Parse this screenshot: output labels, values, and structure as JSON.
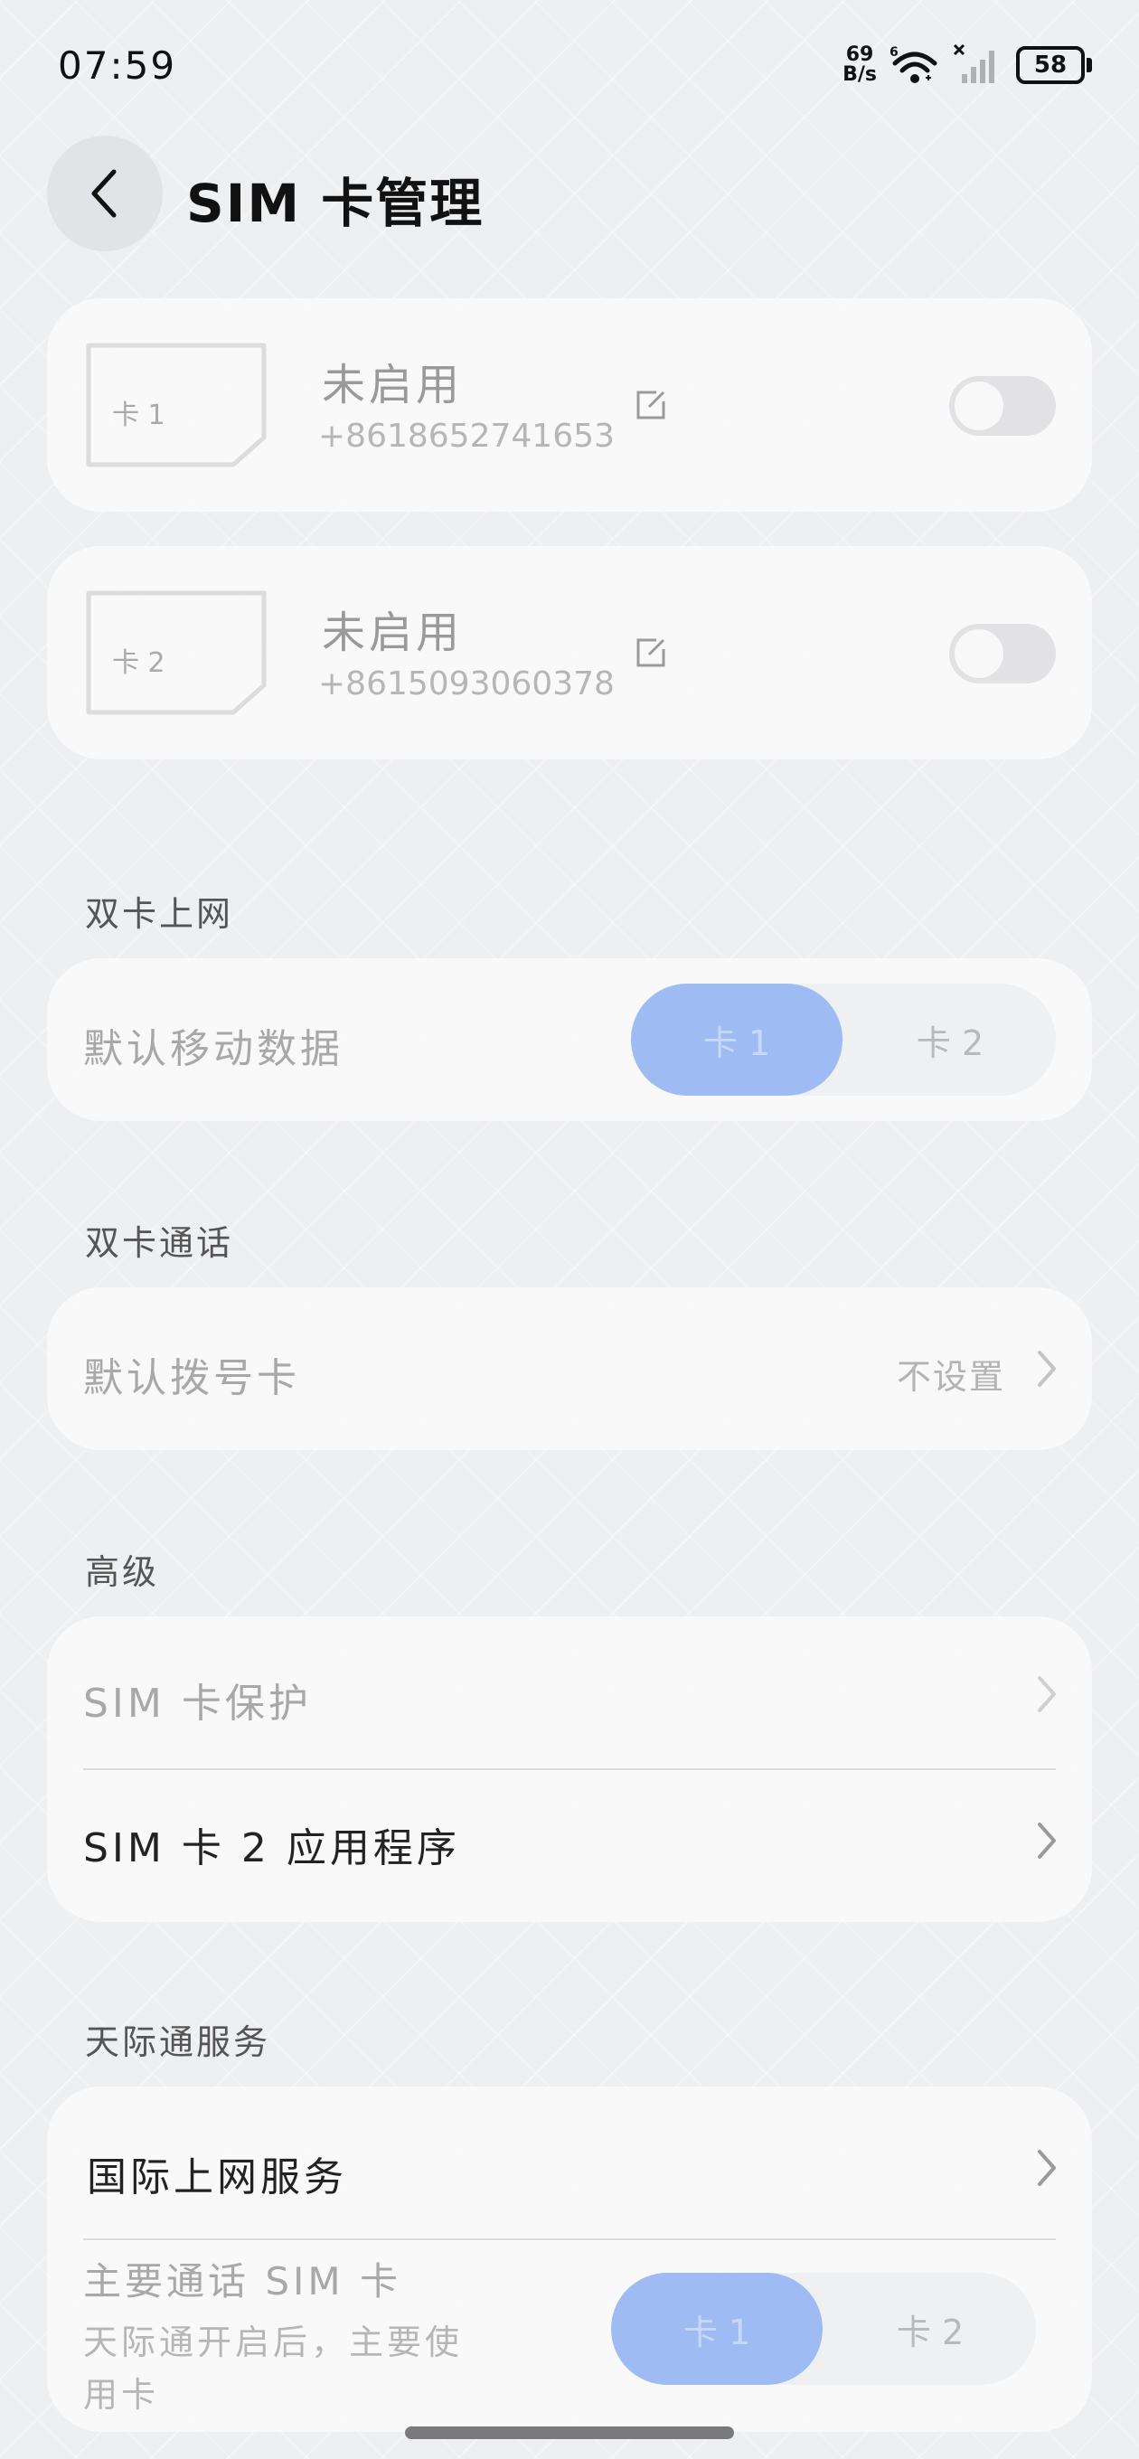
{
  "status_bar": {
    "time": "07:59",
    "net_speed_value": "69",
    "net_speed_unit": "B/s",
    "battery": "58"
  },
  "header": {
    "title": "SIM 卡管理"
  },
  "sim_cards": [
    {
      "label": "卡 1",
      "status": "未启用",
      "number": "+8618652741653",
      "enabled": false
    },
    {
      "label": "卡 2",
      "status": "未启用",
      "number": "+8615093060378",
      "enabled": false
    }
  ],
  "dual_data": {
    "section": "双卡上网",
    "row_label": "默认移动数据",
    "options": [
      "卡 1",
      "卡 2"
    ],
    "selected": "卡 1"
  },
  "dual_call": {
    "section": "双卡通话",
    "row_label": "默认拨号卡",
    "value": "不设置"
  },
  "advanced": {
    "section": "高级",
    "items": [
      "SIM 卡保护",
      "SIM 卡 2 应用程序"
    ]
  },
  "tianjitong": {
    "section": "天际通服务",
    "item": "国际上网服务",
    "primary_label": "主要通话 SIM 卡",
    "primary_desc_line1": "天际通开启后，主要使",
    "primary_desc_line2": "用卡",
    "options": [
      "卡 1",
      "卡 2"
    ],
    "selected": "卡 1"
  },
  "colors": {
    "accent": "#9ebcf3",
    "background": "#eeeff1"
  }
}
